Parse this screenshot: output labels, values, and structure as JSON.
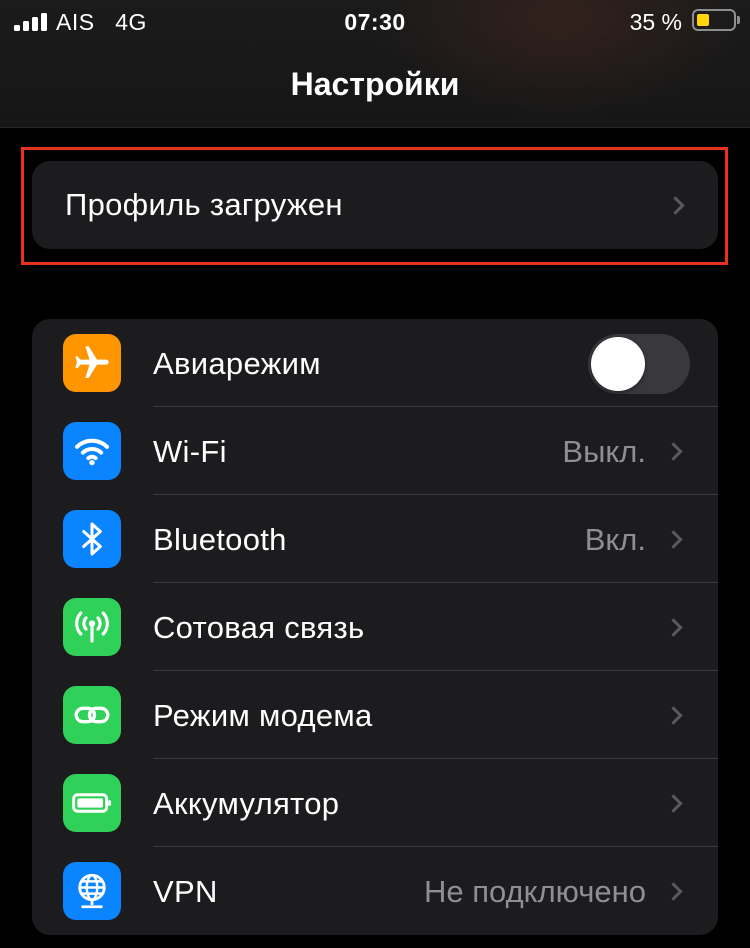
{
  "status_bar": {
    "carrier": "AIS   4G",
    "time": "07:30",
    "battery_percent": "35 %",
    "battery_level": 0.35,
    "signal_bars": 4
  },
  "nav": {
    "title": "Настройки"
  },
  "profile": {
    "label": "Профиль загружен"
  },
  "settings": {
    "items": [
      {
        "label": "Авиарежим",
        "icon": "airplane-icon",
        "color": "#ff9500",
        "toggle_on": false
      },
      {
        "label": "Wi-Fi",
        "icon": "wifi-icon",
        "color": "#0a84ff",
        "value": "Выкл."
      },
      {
        "label": "Bluetooth",
        "icon": "bluetooth-icon",
        "color": "#0a84ff",
        "value": "Вкл."
      },
      {
        "label": "Сотовая связь",
        "icon": "antenna-icon",
        "color": "#30d158"
      },
      {
        "label": "Режим модема",
        "icon": "chain-link-icon",
        "color": "#30d158"
      },
      {
        "label": "Аккумулятор",
        "icon": "battery-icon",
        "color": "#30d158"
      },
      {
        "label": "VPN",
        "icon": "globe-network-icon",
        "color": "#0a84ff",
        "value": "Не подключено"
      }
    ]
  },
  "colors": {
    "highlight": "#e8321e",
    "cell_background": "#1c1c1e",
    "battery_fill": "#ffd60a"
  }
}
